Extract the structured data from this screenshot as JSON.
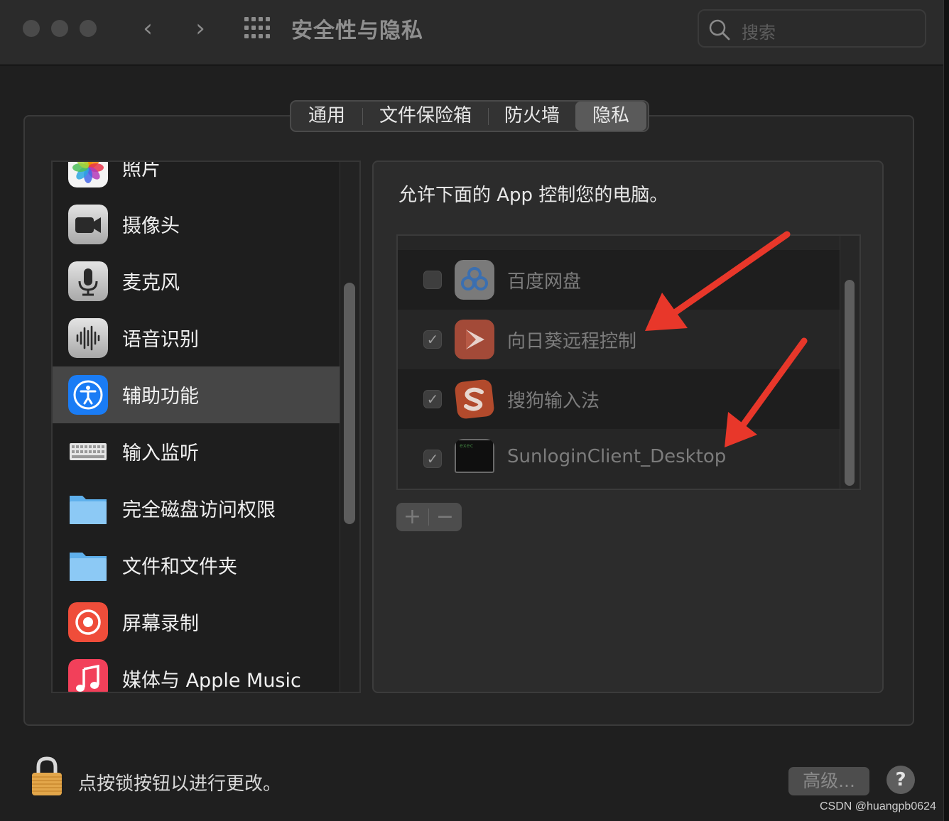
{
  "window": {
    "title": "安全性与隐私",
    "search_placeholder": "搜索"
  },
  "tabs": [
    {
      "label": "通用",
      "active": false
    },
    {
      "label": "文件保险箱",
      "active": false
    },
    {
      "label": "防火墙",
      "active": false
    },
    {
      "label": "隐私",
      "active": true
    }
  ],
  "sidebar": {
    "items": [
      {
        "label": "照片",
        "icon": "photos-icon"
      },
      {
        "label": "摄像头",
        "icon": "camera-icon"
      },
      {
        "label": "麦克风",
        "icon": "microphone-icon"
      },
      {
        "label": "语音识别",
        "icon": "speech-recognition-icon"
      },
      {
        "label": "辅助功能",
        "icon": "accessibility-icon",
        "selected": true
      },
      {
        "label": "输入监听",
        "icon": "keyboard-icon"
      },
      {
        "label": "完全磁盘访问权限",
        "icon": "folder-icon"
      },
      {
        "label": "文件和文件夹",
        "icon": "folder-icon"
      },
      {
        "label": "屏幕录制",
        "icon": "screen-record-icon"
      },
      {
        "label": "媒体与 Apple Music",
        "icon": "music-icon"
      }
    ]
  },
  "detail": {
    "heading": "允许下面的 App 控制您的电脑。",
    "apps": [
      {
        "label": "百度网盘",
        "checked": false,
        "icon": "baidu-netdisk-icon"
      },
      {
        "label": "向日葵远程控制",
        "checked": true,
        "icon": "sunlogin-icon"
      },
      {
        "label": "搜狗输入法",
        "checked": true,
        "icon": "sogou-icon"
      },
      {
        "label": "SunloginClient_Desktop",
        "checked": true,
        "icon": "exec-terminal-icon",
        "icon_text": "exec"
      }
    ],
    "add_label": "+",
    "remove_label": "−"
  },
  "footer": {
    "lock_text": "点按锁按钮以进行更改。",
    "advanced_label": "高级...",
    "help_label": "?",
    "watermark": "CSDN @huangpb0624"
  },
  "colors": {
    "background": "#1f1f1f",
    "selected_row": "#464646",
    "arrow": "#e8372a",
    "accessibility_blue": "#1a7cf5"
  }
}
